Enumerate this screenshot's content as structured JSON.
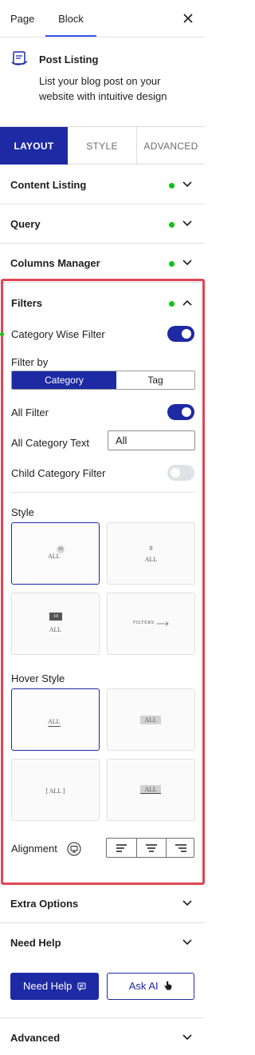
{
  "top_tabs": {
    "page": "Page",
    "block": "Block"
  },
  "block": {
    "title": "Post Listing",
    "description": "List your blog post on your website with intuitive design"
  },
  "main_tabs": {
    "layout": "LAYOUT",
    "style": "STYLE",
    "advanced": "ADVANCED"
  },
  "panels": {
    "content_listing": "Content Listing",
    "query": "Query",
    "columns_manager": "Columns Manager",
    "extra_options": "Extra Options",
    "need_help": "Need Help",
    "advanced": "Advanced"
  },
  "filters": {
    "title": "Filters",
    "category_wise_filter": "Category Wise Filter",
    "filter_by_label": "Filter by",
    "filter_by_options": [
      "Category",
      "Tag"
    ],
    "filter_by_selected": "Category",
    "all_filter": "All Filter",
    "all_category_text_label": "All Category Text",
    "all_category_text_value": "All",
    "child_category_filter": "Child Category Filter",
    "toggles": {
      "category_wise_filter": true,
      "all_filter": true,
      "child_category_filter": false
    },
    "style_label": "Style",
    "style_previews": {
      "s1_text": "ALL",
      "s1_badge": "10",
      "s2_number": "8",
      "s2_text": "ALL",
      "s3_badge": "10",
      "s3_text": "ALL",
      "s4_text": "FILTERS"
    },
    "hover_style_label": "Hover Style",
    "hover_previews": {
      "h1": "ALL",
      "h2": "ALL",
      "h3": "[ ALL ]",
      "h4": "ALL"
    },
    "alignment_label": "Alignment"
  },
  "buttons": {
    "need_help": "Need Help",
    "ask_ai": "Ask AI"
  },
  "colors": {
    "accent": "#1d2aa4",
    "status_dot": "#10c312",
    "highlight_border": "#e04652"
  }
}
